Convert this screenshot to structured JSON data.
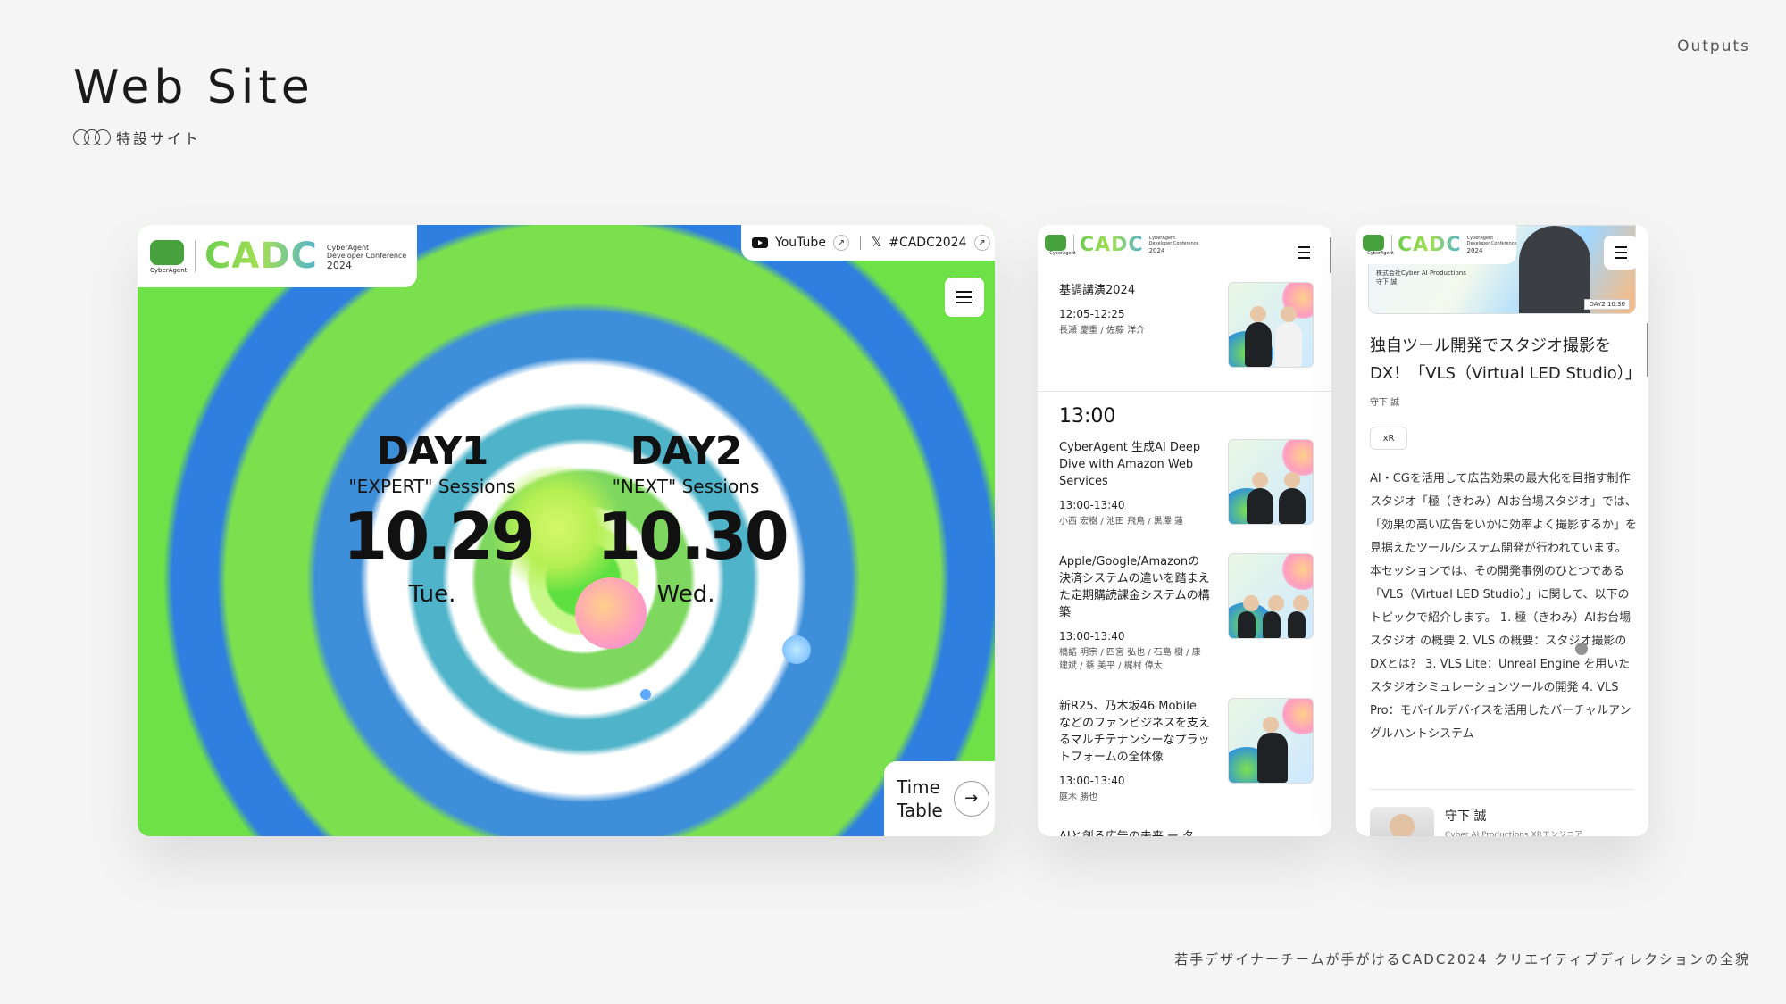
{
  "header": {
    "outputs_label": "Outputs",
    "title": "Web Site",
    "subtitle": "特設サイト"
  },
  "footer": {
    "caption": "若手デザイナーチームが手がけるCADC2024 クリエイティブディレクションの全貌"
  },
  "brand": {
    "ca_label": "CyberAgent",
    "cadc": "CADC",
    "conf_line1": "CyberAgent",
    "conf_line2": "Developer Conference",
    "conf_year": "2024",
    "accent": "#5fe041"
  },
  "desktop": {
    "social": {
      "youtube": "YouTube",
      "hashtag": "#CADC2024",
      "arrow": "↗",
      "x_icon": "𝕏"
    },
    "days": [
      {
        "label": "DAY1",
        "session": "\"EXPERT\" Sessions",
        "date": "10.29",
        "weekday": "Tue."
      },
      {
        "label": "DAY2",
        "session": "\"NEXT\" Sessions",
        "date": "10.30",
        "weekday": "Wed."
      }
    ],
    "timetable": {
      "line1": "Time",
      "line2": "Table",
      "arrow": "→"
    }
  },
  "timetable_phone": {
    "sessions_top": [
      {
        "title": "基調講演2024",
        "time": "12:05-12:25",
        "speakers": "長瀬 慶重 / 佐藤 洋介"
      }
    ],
    "time_head": "13:00",
    "sessions": [
      {
        "title": "CyberAgent 生成AI Deep Dive with Amazon Web Services",
        "time": "13:00-13:40",
        "speakers": "小西 宏樹 / 池田 飛鳥 / 黒澤 蓮"
      },
      {
        "title": "Apple/Google/Amazonの決済システムの違いを踏まえた定期購読課金システムの構築",
        "time": "13:00-13:40",
        "speakers": "橋詰 明宗 / 四宮 弘也 / 石島 樹 / 康 建斌 / 蔡 美平 / 梶村 偉太"
      },
      {
        "title": "新R25、乃木坂46 Mobile などのファンビジネスを支えるマルチテナンシーなプラットフォームの全体像",
        "time": "13:00-13:40",
        "speakers": "庭木 勝也"
      }
    ],
    "next_title": "AIと創る広告の未来 ー タ"
  },
  "article_phone": {
    "hero_who_line1": "株式会社Cyber AI Productions",
    "hero_who_line2": "守下 誠",
    "hero_date": "DAY2 10.30",
    "title": "独自ツール開発でスタジオ撮影をDX！「VLS（Virtual LED Studio）」",
    "author": "守下 誠",
    "tag": "xR",
    "body": "AI・CGを活用して広告効果の最大化を目指す制作スタジオ「極（きわみ）AIお台場スタジオ」では、「効果の高い広告をいかに効率よく撮影するか」を見据えたツール/システム開発が行われています。本セッションでは、その開発事例のひとつである「VLS（Virtual LED Studio）」に関して、以下のトピックで紹介します。 1. 極（きわみ）AIお台場スタジオ の概要 2. VLS の概要：スタジオ撮影のDXとは？ 3. VLS Lite：Unreal Engine を用いたスタジオシミュレーションツールの開発 4. VLS Pro：モバイルデバイスを活用したバーチャルアングルハントシステム",
    "speaker_name": "守下 誠",
    "speaker_role": "Cyber AI Productions XRエンジニア"
  }
}
